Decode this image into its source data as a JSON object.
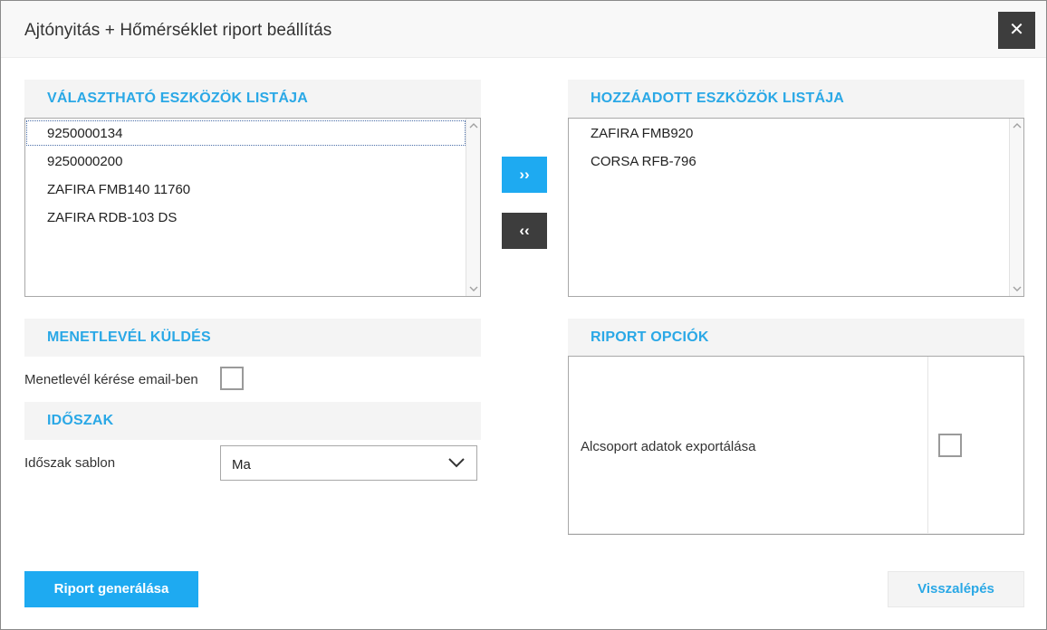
{
  "dialog": {
    "title": "Ajtónyitás + Hőmérséklet riport beállítás",
    "close_symbol": "✕"
  },
  "available": {
    "header": "VÁLASZTHATÓ ESZKÖZÖK LISTÁJA",
    "items": [
      "9250000134",
      "9250000200",
      "ZAFIRA FMB140 11760",
      "ZAFIRA RDB-103 DS"
    ]
  },
  "added": {
    "header": "HOZZÁADOTT ESZKÖZÖK LISTÁJA",
    "items": [
      "ZAFIRA FMB920",
      "CORSA RFB-796"
    ]
  },
  "transfer": {
    "add_label": "››",
    "remove_label": "‹‹"
  },
  "waybill": {
    "header": "MENETLEVÉL KÜLDÉS",
    "email_label": "Menetlevél kérése email-ben",
    "email_checked": false
  },
  "period": {
    "header": "IDŐSZAK",
    "template_label": "Időszak sablon",
    "template_value": "Ma"
  },
  "report_options": {
    "header": "RIPORT OPCIÓK",
    "subgroup_label": "Alcsoport adatok exportálása",
    "subgroup_checked": false
  },
  "footer": {
    "generate_label": "Riport generálása",
    "back_label": "Visszalépés"
  },
  "colors": {
    "accent": "#1eaaf1",
    "header_text": "#2aa8e6",
    "dark_button": "#3d3d3d"
  }
}
